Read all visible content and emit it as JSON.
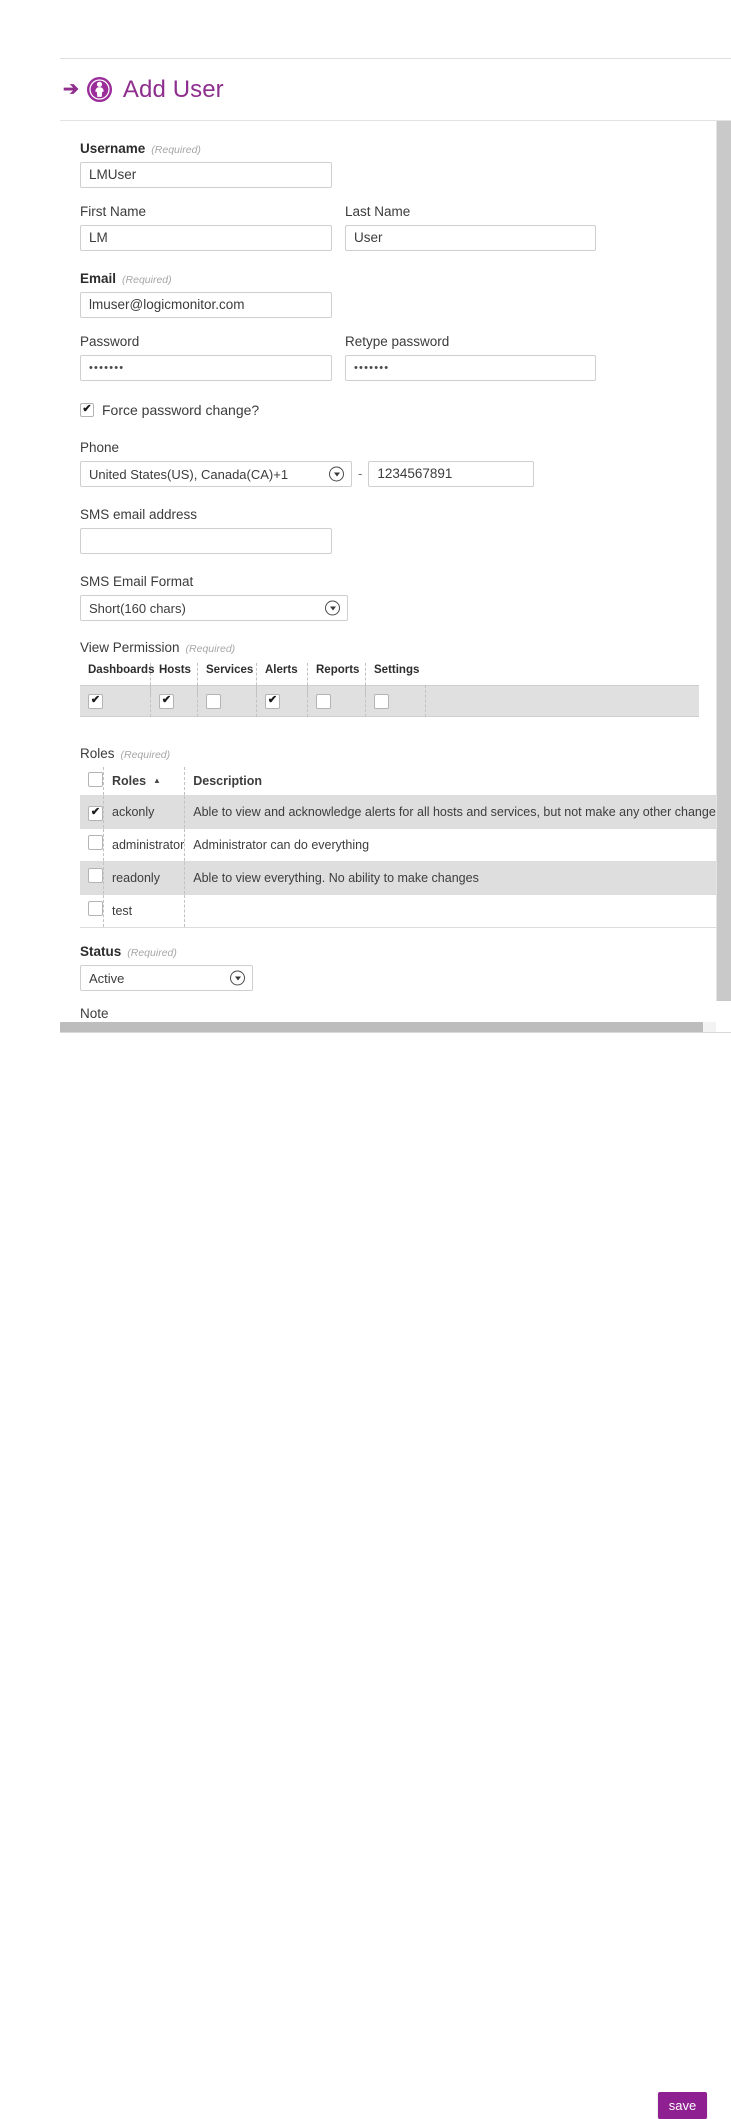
{
  "window": {
    "close_label": "✕",
    "accent_color": "#8e2f8e",
    "save_button_color": "#8e2091"
  },
  "header": {
    "arrow": "➔",
    "icon": "user-avatar-icon",
    "title": "Add User"
  },
  "form": {
    "required_note": "(Required)",
    "username": {
      "label": "Username",
      "required": "(Required)",
      "value": "LMUser"
    },
    "first_name": {
      "label": "First Name",
      "value": "LM"
    },
    "last_name": {
      "label": "Last Name",
      "value": "User"
    },
    "email": {
      "label": "Email",
      "required": "(Required)",
      "value": "lmuser@logicmonitor.com"
    },
    "password": {
      "label": "Password",
      "value": "•••••••"
    },
    "retype_password": {
      "label": "Retype password",
      "value": "•••••••"
    },
    "force_password_change": {
      "label": "Force password change?",
      "checked": true,
      "mark": "✔"
    },
    "phone": {
      "label": "Phone",
      "country_value": "United States(US), Canada(CA)+1",
      "separator": "-",
      "number_value": "1234567891"
    },
    "sms_email_address": {
      "label": "SMS email address",
      "value": ""
    },
    "sms_email_format": {
      "label": "SMS Email Format",
      "value": "Short(160 chars)"
    },
    "view_permission": {
      "label": "View Permission",
      "required": "(Required)",
      "columns": [
        "Dashboards",
        "Hosts",
        "Services",
        "Alerts",
        "Reports",
        "Settings"
      ],
      "checked": [
        true,
        true,
        false,
        true,
        false,
        false
      ],
      "mark": "✔"
    },
    "roles": {
      "label": "Roles",
      "required": "(Required)",
      "columns": [
        "",
        "Roles",
        "Description"
      ],
      "sort_column": "Roles",
      "sort_arrow": "▲",
      "header_checkbox_checked": false,
      "mark": "✔",
      "rows": [
        {
          "checked": true,
          "name": "ackonly",
          "description": "Able to view and acknowledge alerts for all hosts and services, but not make any other changes"
        },
        {
          "checked": false,
          "name": "administrator",
          "description": "Administrator can do everything"
        },
        {
          "checked": false,
          "name": "readonly",
          "description": "Able to view everything. No ability to make changes"
        },
        {
          "checked": false,
          "name": "test",
          "description": ""
        }
      ]
    },
    "status": {
      "label": "Status",
      "required": "(Required)",
      "value": "Active"
    },
    "note": {
      "label": "Note"
    }
  },
  "footer": {
    "save_label": "save"
  }
}
